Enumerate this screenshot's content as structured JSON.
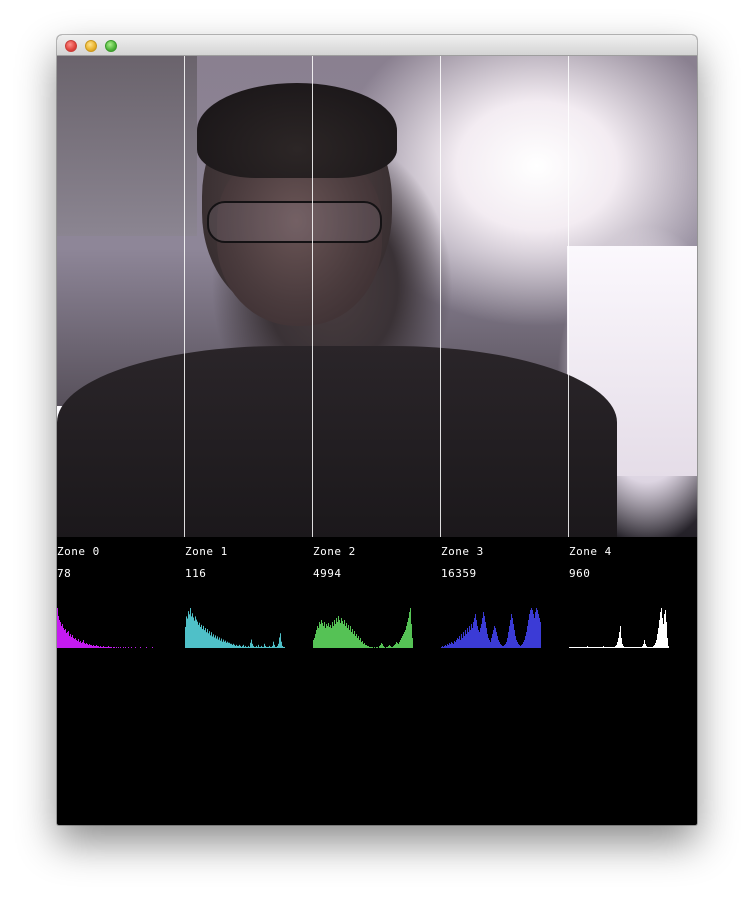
{
  "zones": [
    {
      "label": "Zone 0",
      "count": "78",
      "color": "#c51bf0",
      "hist": [
        40,
        32,
        28,
        26,
        22,
        24,
        20,
        18,
        19,
        15,
        16,
        17,
        12,
        14,
        11,
        13,
        10,
        9,
        10,
        8,
        7,
        9,
        6,
        7,
        5,
        6,
        8,
        5,
        4,
        5,
        4,
        3,
        4,
        3,
        3,
        2,
        3,
        2,
        2,
        3,
        2,
        2,
        1,
        2,
        1,
        1,
        2,
        1,
        1,
        1,
        1,
        2,
        1,
        1,
        1,
        0,
        1,
        1,
        0,
        1,
        0,
        1,
        0,
        1,
        0,
        0,
        1,
        0,
        1,
        0,
        0,
        1,
        0,
        0,
        1,
        0,
        0,
        0,
        1,
        0,
        0,
        0,
        0,
        1,
        0,
        0,
        0,
        0,
        0,
        1,
        0,
        0,
        0,
        0,
        0,
        1,
        0,
        0,
        0,
        0
      ]
    },
    {
      "label": "Zone 1",
      "count": "116",
      "color": "#4fc0c8",
      "hist": [
        20,
        30,
        28,
        35,
        32,
        38,
        30,
        33,
        29,
        26,
        30,
        27,
        25,
        22,
        24,
        20,
        22,
        18,
        21,
        17,
        19,
        15,
        18,
        14,
        16,
        12,
        15,
        11,
        13,
        10,
        12,
        9,
        11,
        8,
        10,
        7,
        9,
        6,
        8,
        6,
        7,
        5,
        6,
        5,
        5,
        4,
        4,
        3,
        4,
        3,
        2,
        3,
        2,
        2,
        3,
        2,
        1,
        2,
        3,
        1,
        2,
        1,
        1,
        2,
        1,
        5,
        8,
        4,
        2,
        1,
        1,
        2,
        1,
        3,
        1,
        1,
        2,
        1,
        1,
        4,
        2,
        1,
        1,
        1,
        2,
        1,
        1,
        2,
        6,
        3,
        1,
        1,
        2,
        4,
        10,
        14,
        6,
        2,
        1,
        1
      ]
    },
    {
      "label": "Zone 2",
      "count": "4994",
      "color": "#55c255",
      "hist": [
        8,
        10,
        14,
        18,
        22,
        20,
        26,
        24,
        28,
        25,
        22,
        26,
        20,
        24,
        22,
        25,
        21,
        23,
        20,
        26,
        22,
        28,
        24,
        30,
        26,
        32,
        28,
        25,
        30,
        27,
        24,
        28,
        22,
        25,
        20,
        23,
        18,
        22,
        16,
        19,
        14,
        17,
        12,
        14,
        10,
        12,
        8,
        10,
        6,
        7,
        4,
        5,
        3,
        3,
        2,
        2,
        1,
        1,
        1,
        1,
        0,
        1,
        0,
        1,
        1,
        0,
        2,
        3,
        5,
        4,
        2,
        1,
        0,
        1,
        1,
        2,
        3,
        2,
        1,
        1,
        2,
        3,
        4,
        6,
        5,
        4,
        6,
        8,
        10,
        12,
        14,
        16,
        18,
        22,
        26,
        30,
        36,
        40,
        24,
        10
      ]
    },
    {
      "label": "Zone 3",
      "count": "16359",
      "color": "#3b3bd6",
      "hist": [
        1,
        2,
        1,
        2,
        3,
        2,
        4,
        3,
        5,
        4,
        6,
        5,
        4,
        7,
        6,
        8,
        10,
        9,
        12,
        8,
        14,
        10,
        16,
        12,
        18,
        14,
        20,
        16,
        22,
        18,
        24,
        20,
        26,
        30,
        34,
        28,
        22,
        18,
        16,
        20,
        24,
        30,
        36,
        32,
        26,
        20,
        14,
        10,
        8,
        6,
        10,
        14,
        18,
        22,
        20,
        16,
        12,
        8,
        6,
        4,
        3,
        2,
        2,
        3,
        4,
        6,
        10,
        16,
        22,
        28,
        34,
        30,
        24,
        18,
        12,
        8,
        6,
        4,
        3,
        2,
        3,
        4,
        6,
        8,
        12,
        16,
        22,
        28,
        34,
        38,
        40,
        38,
        34,
        30,
        36,
        40,
        38,
        34,
        30,
        26
      ]
    },
    {
      "label": "Zone 4",
      "count": "960",
      "color": "#ffffff",
      "hist": [
        1,
        1,
        1,
        1,
        1,
        1,
        1,
        1,
        1,
        1,
        1,
        1,
        1,
        1,
        1,
        1,
        1,
        1,
        2,
        1,
        1,
        1,
        1,
        1,
        1,
        1,
        1,
        1,
        1,
        1,
        1,
        1,
        1,
        1,
        2,
        1,
        1,
        1,
        1,
        1,
        1,
        1,
        1,
        1,
        1,
        1,
        2,
        3,
        6,
        10,
        16,
        22,
        10,
        4,
        2,
        1,
        1,
        1,
        1,
        1,
        1,
        1,
        1,
        1,
        1,
        1,
        1,
        1,
        1,
        1,
        1,
        1,
        1,
        2,
        4,
        8,
        4,
        2,
        1,
        1,
        1,
        1,
        1,
        1,
        2,
        3,
        5,
        8,
        14,
        20,
        28,
        36,
        40,
        30,
        24,
        34,
        38,
        26,
        10,
        2
      ]
    }
  ]
}
